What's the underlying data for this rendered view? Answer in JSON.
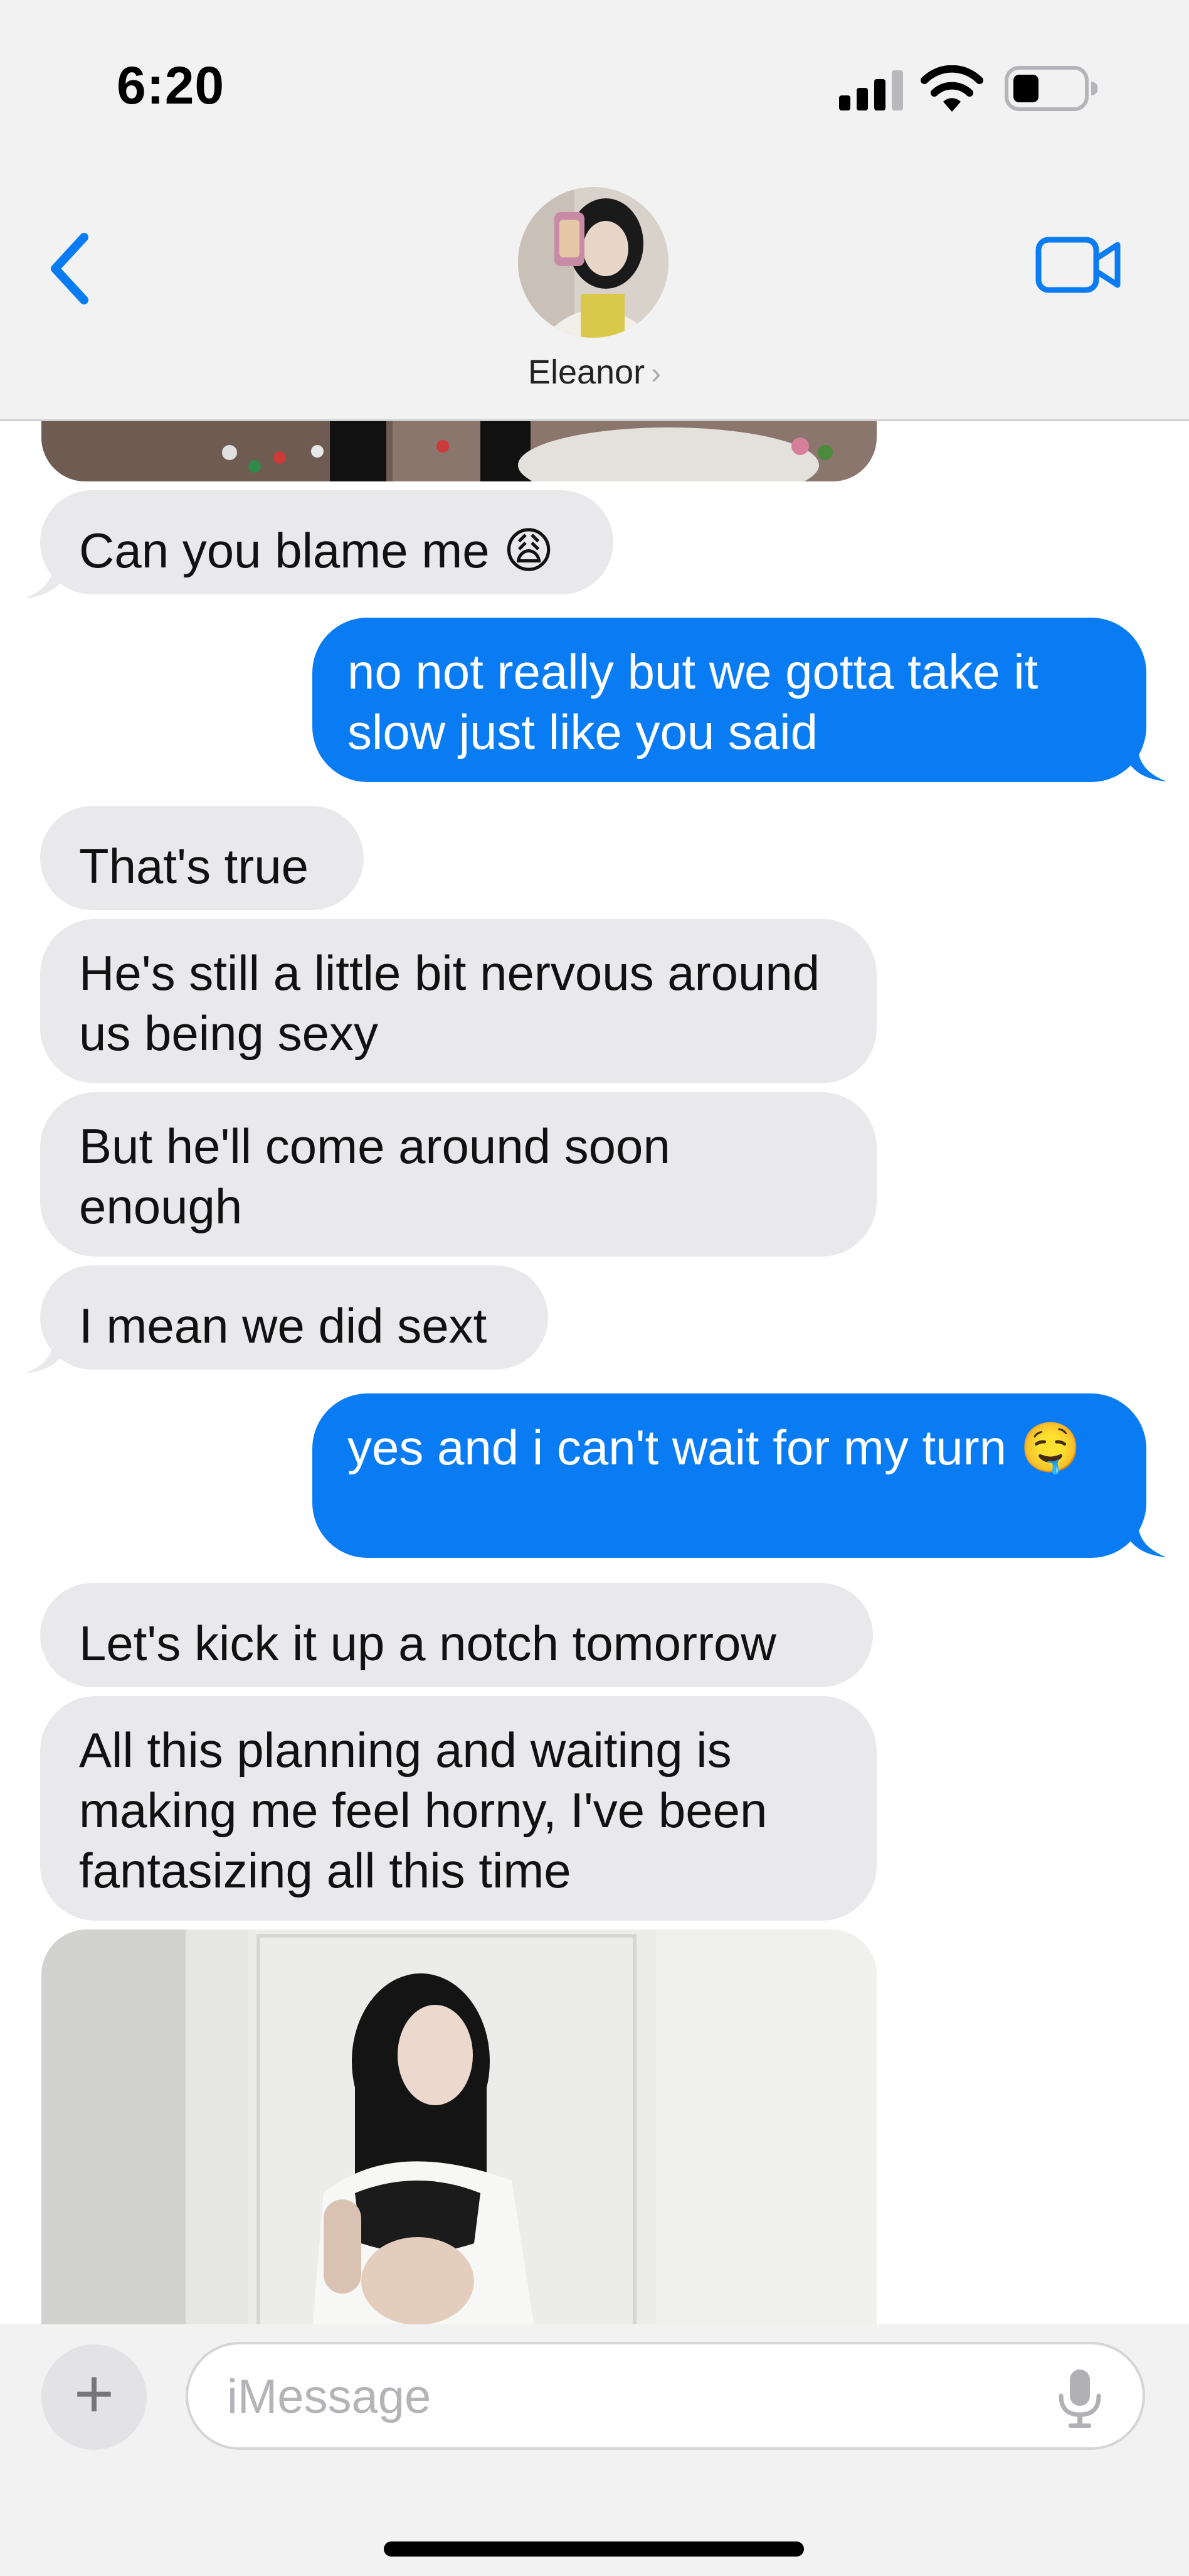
{
  "status_bar": {
    "time": "6:20",
    "battery_icon": "battery-icon",
    "wifi_icon": "wifi-icon",
    "signal_icon": "cellular-signal-icon"
  },
  "header": {
    "contact_name": "Eleanor",
    "chevron": "›",
    "back_icon": "chevron-left-icon",
    "video_icon": "video-camera-icon"
  },
  "colors": {
    "outgoing": "#0a7cf3",
    "incoming": "#e9e9eb",
    "accent": "#0a7cf3"
  },
  "messages": [
    {
      "from": "them",
      "type": "image"
    },
    {
      "from": "them",
      "text": "Can you blame me 😩"
    },
    {
      "from": "me",
      "text": "no not really but we gotta take it slow just like you said"
    },
    {
      "from": "them",
      "text": "That's true"
    },
    {
      "from": "them",
      "text": "He's still a little bit nervous around us being sexy"
    },
    {
      "from": "them",
      "text": "But he'll come around soon enough"
    },
    {
      "from": "them",
      "text": "I mean we did sext"
    },
    {
      "from": "me",
      "text": "yes and i can't wait for my turn 🤤"
    },
    {
      "from": "them",
      "text": "Let's kick it up a notch tomorrow"
    },
    {
      "from": "them",
      "text": "All this planning and waiting is making me feel horny, I've been fantasizing all this time"
    },
    {
      "from": "them",
      "type": "image"
    }
  ],
  "composer": {
    "placeholder": "iMessage",
    "value": "",
    "plus_label": "+"
  }
}
